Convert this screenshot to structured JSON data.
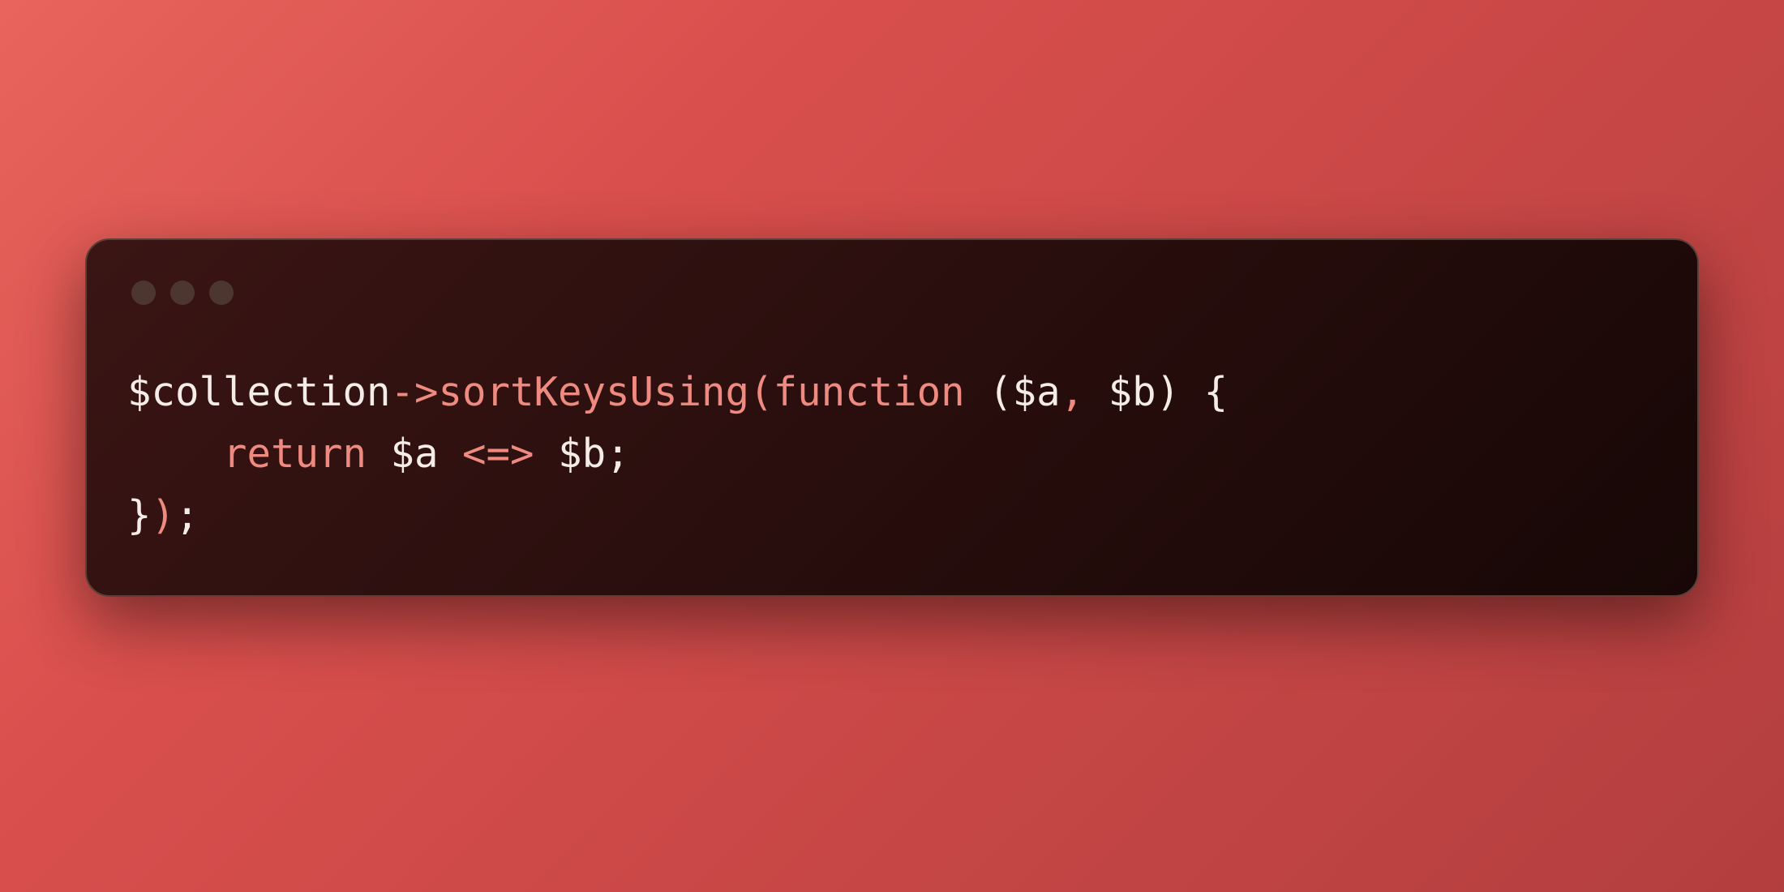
{
  "colors": {
    "background_gradient_from": "#e8645c",
    "background_gradient_to": "#b33e3e",
    "window_gradient_from": "#3a1514",
    "window_gradient_to": "#170706",
    "text_default": "#f4ece7",
    "text_accent": "#ef8a80"
  },
  "window": {
    "traffic_light_icons": [
      "circle-icon",
      "circle-icon",
      "circle-icon"
    ]
  },
  "code": {
    "line1": {
      "t1": "$collection",
      "t2": "->",
      "t3": "sortKeysUsing",
      "t4": "(",
      "t5": "function",
      "t6": " ($a",
      "t7": ",",
      "t8": " $b) {"
    },
    "line2": {
      "indent": "    ",
      "t1": "return",
      "t2": " $a ",
      "t3": "<=>",
      "t4": " $b;"
    },
    "line3": {
      "t1": "}",
      "t2": ")",
      "t3": ";"
    }
  }
}
